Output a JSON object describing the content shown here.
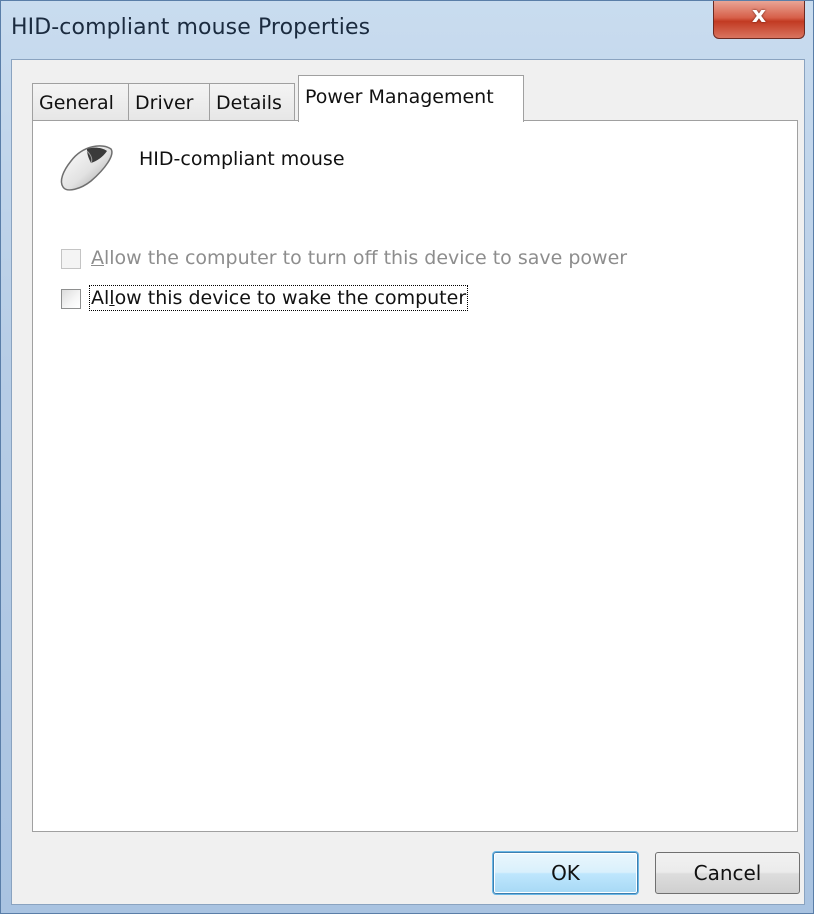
{
  "window": {
    "title": "HID-compliant mouse Properties",
    "close_glyph": "x"
  },
  "tabs": [
    {
      "label": "General",
      "active": false
    },
    {
      "label": "Driver",
      "active": false
    },
    {
      "label": "Details",
      "active": false
    },
    {
      "label": "Power Management",
      "active": true
    }
  ],
  "device": {
    "icon": "mouse-icon",
    "name": "HID-compliant mouse"
  },
  "options": [
    {
      "label_accel": "A",
      "label_rest": "llow the computer to turn off this device to save power",
      "checked": false,
      "enabled": false
    },
    {
      "label_pre": "Al",
      "label_accel": "l",
      "label_rest": "ow this device to wake the computer",
      "checked": false,
      "enabled": true,
      "focused": true
    }
  ],
  "buttons": {
    "ok": "OK",
    "cancel": "Cancel"
  },
  "colors": {
    "title_bar": "#b7cde6",
    "close_button": "#c23a22",
    "dialog_bg": "#f0f0f0",
    "panel_bg": "#ffffff",
    "disabled_text": "#8d8d8d",
    "default_button": "#bee6fd"
  }
}
